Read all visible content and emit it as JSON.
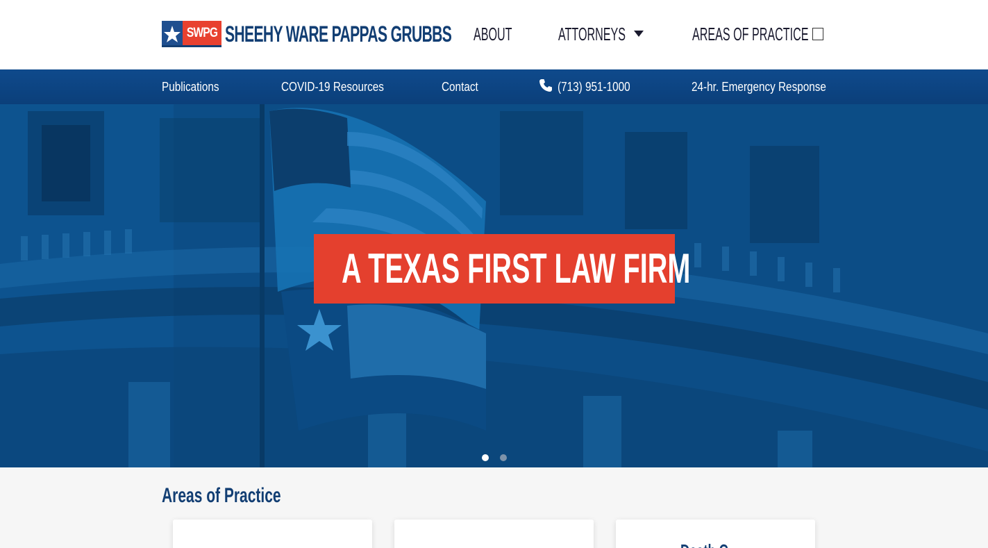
{
  "brand": {
    "badge": "SWPG",
    "name": "SHEEHY WARE PAPPAS GRUBBS"
  },
  "main_nav": {
    "about": "ABOUT",
    "attorneys": "ATTORNEYS",
    "areas": "AREAS OF PRACTICE"
  },
  "sub_nav": {
    "publications": "Publications",
    "covid": "COVID-19 Resources",
    "contact": "Contact",
    "phone": "(713) 951-1000",
    "emergency": "24-hr. Emergency Response"
  },
  "hero": {
    "title": "A TEXAS FIRST LAW FIRM",
    "slides": 2,
    "active_slide": 1
  },
  "practice": {
    "title": "Areas of Practice",
    "cards": [
      "",
      "",
      "Death C..."
    ]
  },
  "colors": {
    "navy": "#123e73",
    "blue_bar": "#0f4a8c",
    "red": "#e4402e"
  },
  "icons": [
    "star-icon",
    "chevron-down-icon",
    "square-toggle-icon",
    "phone-icon"
  ]
}
